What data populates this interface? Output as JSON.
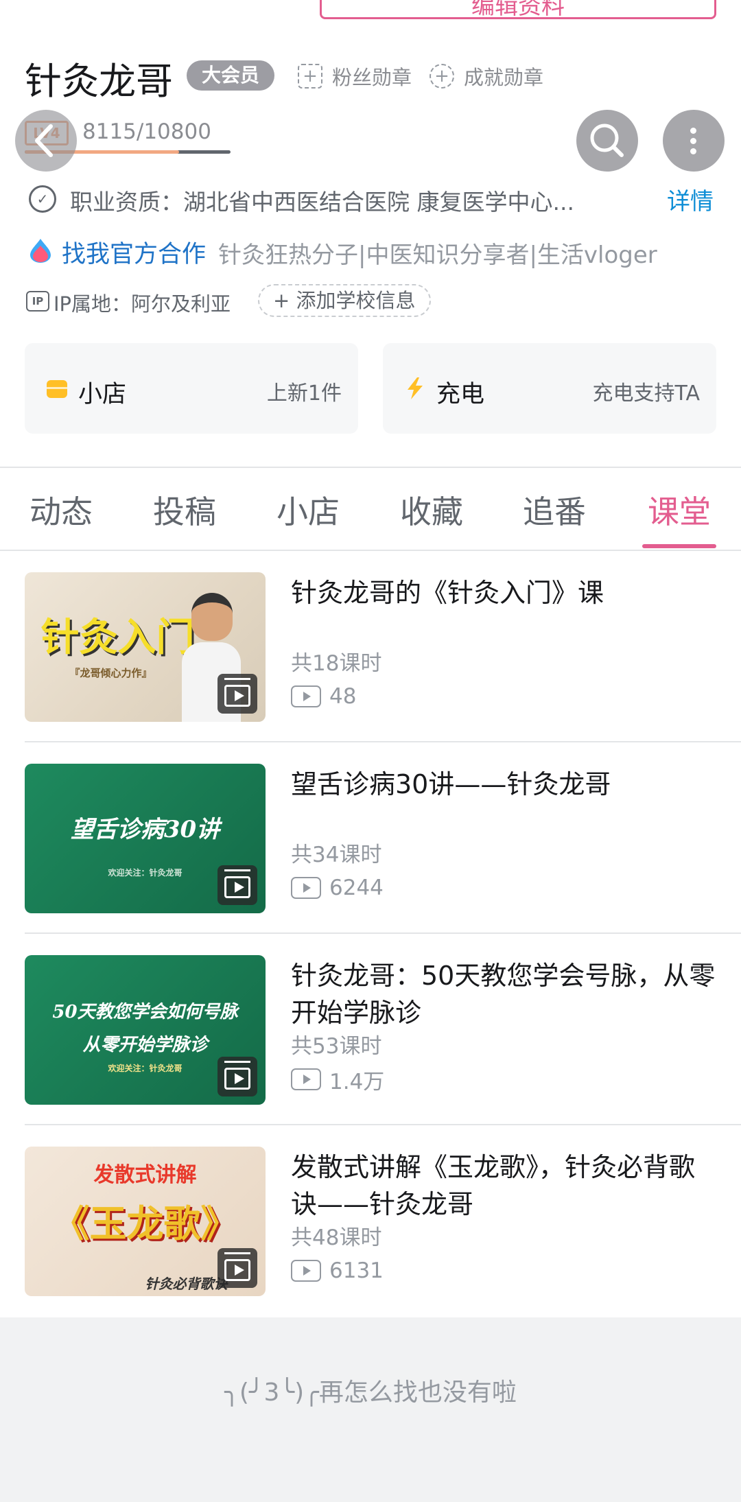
{
  "profile": {
    "edit_button_label": "编辑资料",
    "name": "针灸龙哥",
    "vip_badge": "大会员",
    "fan_medal_label": "粉丝勋章",
    "achievement_medal_label": "成就勋章",
    "level_icon": "LV4",
    "exp_text": "8115/10800",
    "exp_progress": 0.751,
    "qualification": "职业资质：湖北省中西医结合医院 康复医学中心...",
    "qualification_detail_label": "详情",
    "collab_link": "找我官方合作",
    "signature": "针灸狂热分子|中医知识分享者|生活vloger",
    "ip_icon": "IP",
    "ip_location": "IP属地：阿尔及利亚",
    "add_school_label": "添加学校信息"
  },
  "cards": {
    "shop": {
      "label": "小店",
      "note": "上新1件",
      "icon": "shop-icon",
      "color": "#ffbf26"
    },
    "charge": {
      "label": "充电",
      "note": "充电支持TA",
      "icon": "lightning-icon",
      "color": "#ffbf26"
    }
  },
  "tabs": [
    {
      "label": "动态",
      "active": false
    },
    {
      "label": "投稿",
      "active": false
    },
    {
      "label": "小店",
      "active": false
    },
    {
      "label": "收藏",
      "active": false
    },
    {
      "label": "追番",
      "active": false
    },
    {
      "label": "课堂",
      "active": true
    }
  ],
  "courses": [
    {
      "title": "针灸龙哥的《针灸入门》课",
      "lessons": "共18课时",
      "views": "48",
      "thumb_text": "针灸入门",
      "thumb_sub": "『龙哥倾心力作』"
    },
    {
      "title": "望舌诊病30讲——针灸龙哥",
      "lessons": "共34课时",
      "views": "6244",
      "thumb_text": "望舌诊病30讲",
      "thumb_sub": "欢迎关注：针灸龙哥"
    },
    {
      "title": "针灸龙哥：50天教您学会号脉，从零开始学脉诊",
      "lessons": "共53课时",
      "views": "1.4万",
      "thumb_text": "50天教您学会如何号脉",
      "thumb_text2": "从零开始学脉诊",
      "thumb_sub": "欢迎关注：针灸龙哥"
    },
    {
      "title": "发散式讲解《玉龙歌》，针灸必背歌诀——针灸龙哥",
      "lessons": "共48课时",
      "views": "6131",
      "thumb_text": "发散式讲解",
      "thumb_text2": "《玉龙歌》",
      "thumb_sub": "针灸必背歌诀"
    }
  ],
  "footer": {
    "end_text": "╮(╯3╰)╭再怎么找也没有啦"
  },
  "colors": {
    "accent_pink": "#e35d8f",
    "link_blue": "#0f8ed6",
    "level_orange": "#f2a882"
  }
}
